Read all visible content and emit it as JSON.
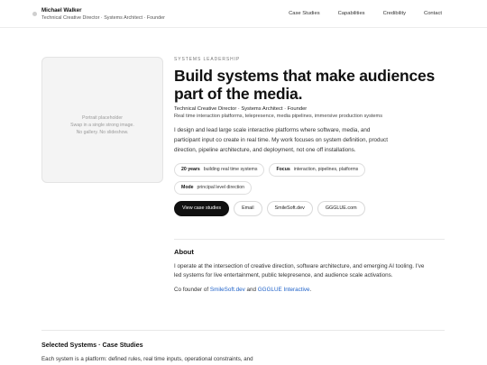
{
  "header": {
    "name": "Michael Walker",
    "tagline": "Technical Creative Director · Systems Architect · Founder",
    "nav": [
      "Case Studies",
      "Capabilities",
      "Credibility",
      "Contact"
    ]
  },
  "portrait": {
    "line1": "Portrait placeholder",
    "line2": "Swap in a single strong image.",
    "line3": "No gallery. No slideshow."
  },
  "hero": {
    "eyebrow": "SYSTEMS LEADERSHIP",
    "headline": "Build systems that make audiences part of the media.",
    "role": "Technical Creative Director · Systems Architect · Founder",
    "role_sub": "Real time interaction platforms, telepresence, media pipelines, immersive production systems",
    "intro": "I design and lead large scale interactive platforms where software, media, and participant input co create in real time. My work focuses on system definition, product direction, pipeline architecture, and deployment, not one off installations."
  },
  "chips": [
    {
      "key": "20 years",
      "value": "building real time systems"
    },
    {
      "key": "Focus",
      "value": "interaction, pipelines, platforms"
    },
    {
      "key": "Mode",
      "value": "principal level direction"
    }
  ],
  "actions": {
    "primary": "View case studies",
    "email": "Email",
    "link1": "SmileSoft.dev",
    "link2": "GGGLUE.com"
  },
  "about": {
    "title": "About",
    "para1": "I operate at the intersection of creative direction, software architecture, and emerging AI tooling. I've led systems for live entertainment, public telepresence, and audience scale activations.",
    "cofounder_prefix": "Co founder of ",
    "link_smilesoft": "SmileSoft.dev",
    "and": " and ",
    "link_ggglue": "GGGLUE Interactive",
    "period": "."
  },
  "selected": {
    "title": "Selected Systems · Case Studies",
    "lead": "Each system is a platform: defined rules, real time inputs, operational constraints, and"
  }
}
